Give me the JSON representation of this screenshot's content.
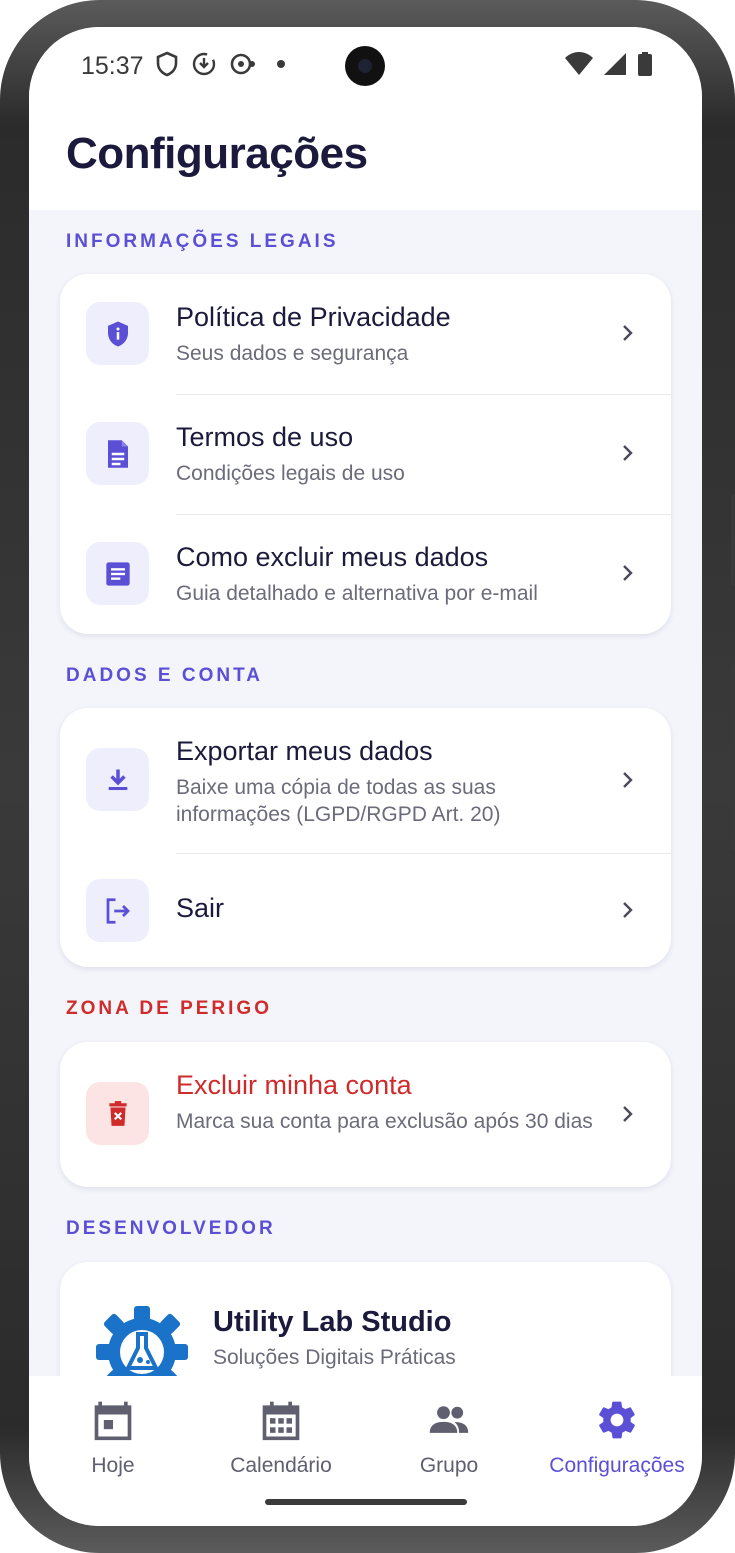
{
  "status_bar": {
    "time": "15:37",
    "left_icons": [
      "shield-icon",
      "download-status-icon",
      "sync-status-icon",
      "dot-icon"
    ],
    "right_icons": [
      "wifi-icon",
      "cellular-signal-icon",
      "battery-icon"
    ]
  },
  "header": {
    "title": "Configurações"
  },
  "sections": {
    "legal": {
      "label": "INFORMAÇÕES LEGAIS",
      "items": [
        {
          "icon": "privacy-shield-icon",
          "title": "Política de Privacidade",
          "subtitle": "Seus dados e segurança"
        },
        {
          "icon": "document-icon",
          "title": "Termos de uso",
          "subtitle": "Condições legais de uso"
        },
        {
          "icon": "article-icon",
          "title": "Como excluir meus dados",
          "subtitle": "Guia detalhado e alternativa por e-mail"
        }
      ]
    },
    "account": {
      "label": "DADOS E CONTA",
      "items": [
        {
          "icon": "download-icon",
          "title": "Exportar meus dados",
          "subtitle": "Baixe uma cópia de todas as suas informações (LGPD/RGPD Art. 20)"
        },
        {
          "icon": "logout-icon",
          "title": "Sair"
        }
      ]
    },
    "danger": {
      "label": "ZONA DE PERIGO",
      "items": [
        {
          "icon": "delete-icon",
          "title": "Excluir minha conta",
          "subtitle": "Marca sua conta para exclusão após 30 dias"
        }
      ]
    },
    "developer": {
      "label": "DESENVOLVEDOR",
      "name": "Utility Lab Studio",
      "tagline": "Soluções Digitais Práticas",
      "logo": "utility-lab-gear-logo"
    }
  },
  "bottom_nav": {
    "items": [
      {
        "icon": "today-icon",
        "label": "Hoje",
        "active": false
      },
      {
        "icon": "calendar-icon",
        "label": "Calendário",
        "active": false
      },
      {
        "icon": "group-icon",
        "label": "Grupo",
        "active": false
      },
      {
        "icon": "settings-gear-icon",
        "label": "Configurações",
        "active": true
      }
    ]
  },
  "colors": {
    "accent": "#5b4fd6",
    "danger": "#d02b2b",
    "title_text": "#1b1a3c",
    "subtitle_text": "#6b6b7a",
    "screen_background": "#f4f5fb"
  }
}
